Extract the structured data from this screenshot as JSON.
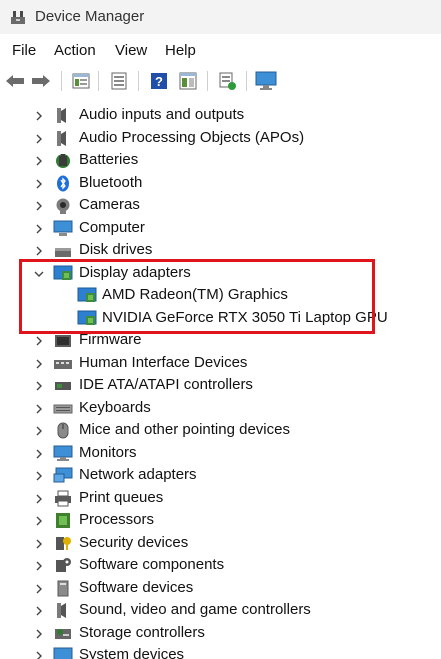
{
  "window": {
    "title": "Device Manager",
    "icon": "device-manager-icon"
  },
  "menu": [
    "File",
    "Action",
    "View",
    "Help"
  ],
  "toolbar": [
    "back-arrow-icon",
    "forward-arrow-icon",
    "properties-icon",
    "device-list-icon",
    "help-icon",
    "view-icon",
    "scan-icon",
    "monitor-icon"
  ],
  "tree": [
    {
      "label": "Audio inputs and outputs",
      "icon": "speaker-icon",
      "expanded": false
    },
    {
      "label": "Audio Processing Objects (APOs)",
      "icon": "speaker-icon",
      "expanded": false
    },
    {
      "label": "Batteries",
      "icon": "battery-icon",
      "expanded": false
    },
    {
      "label": "Bluetooth",
      "icon": "bluetooth-icon",
      "expanded": false
    },
    {
      "label": "Cameras",
      "icon": "camera-icon",
      "expanded": false
    },
    {
      "label": "Computer",
      "icon": "computer-icon",
      "expanded": false
    },
    {
      "label": "Disk drives",
      "icon": "disk-icon",
      "expanded": false
    },
    {
      "label": "Display adapters",
      "icon": "display-adapter-icon",
      "expanded": true,
      "children": [
        {
          "label": "AMD Radeon(TM) Graphics",
          "icon": "display-adapter-icon"
        },
        {
          "label": "NVIDIA GeForce RTX 3050 Ti Laptop GPU",
          "icon": "display-adapter-icon"
        }
      ]
    },
    {
      "label": "Firmware",
      "icon": "firmware-icon",
      "expanded": false
    },
    {
      "label": "Human Interface Devices",
      "icon": "hid-icon",
      "expanded": false
    },
    {
      "label": "IDE ATA/ATAPI controllers",
      "icon": "ide-icon",
      "expanded": false
    },
    {
      "label": "Keyboards",
      "icon": "keyboard-icon",
      "expanded": false
    },
    {
      "label": "Mice and other pointing devices",
      "icon": "mouse-icon",
      "expanded": false
    },
    {
      "label": "Monitors",
      "icon": "monitor-icon",
      "expanded": false
    },
    {
      "label": "Network adapters",
      "icon": "network-icon",
      "expanded": false
    },
    {
      "label": "Print queues",
      "icon": "printer-icon",
      "expanded": false
    },
    {
      "label": "Processors",
      "icon": "processor-icon",
      "expanded": false
    },
    {
      "label": "Security devices",
      "icon": "security-icon",
      "expanded": false
    },
    {
      "label": "Software components",
      "icon": "software-component-icon",
      "expanded": false
    },
    {
      "label": "Software devices",
      "icon": "software-device-icon",
      "expanded": false
    },
    {
      "label": "Sound, video and game controllers",
      "icon": "speaker-icon",
      "expanded": false
    },
    {
      "label": "Storage controllers",
      "icon": "storage-icon",
      "expanded": false
    },
    {
      "label": "System devices",
      "icon": "system-icon",
      "expanded": false
    }
  ],
  "colors": {
    "highlight": "#e0141b",
    "accent": "#1e6fd9"
  }
}
